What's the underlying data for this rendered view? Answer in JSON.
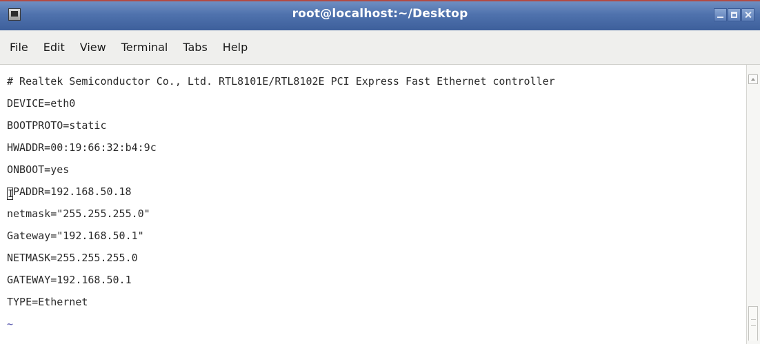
{
  "window": {
    "title": "root@localhost:~/Desktop"
  },
  "menu": {
    "items": [
      {
        "label": "File"
      },
      {
        "label": "Edit"
      },
      {
        "label": "View"
      },
      {
        "label": "Terminal"
      },
      {
        "label": "Tabs"
      },
      {
        "label": "Help"
      }
    ]
  },
  "terminal": {
    "lines": [
      "# Realtek Semiconductor Co., Ltd. RTL8101E/RTL8102E PCI Express Fast Ethernet controller",
      "DEVICE=eth0",
      "BOOTPROTO=static",
      "HWADDR=00:19:66:32:b4:9c",
      "ONBOOT=yes",
      "IPADDR=192.168.50.18",
      "netmask=\"255.255.255.0\"",
      "Gateway=\"192.168.50.1\"",
      "NETMASK=255.255.255.0",
      "GATEWAY=192.168.50.1",
      "TYPE=Ethernet",
      "~",
      "~"
    ],
    "cursor_line": {
      "cursor_char": "I",
      "rest": "PADDR=192.168.50.18"
    }
  },
  "icons": {
    "app": "terminal-icon",
    "minimize": "minimize-icon",
    "maximize": "maximize-icon",
    "close": "close-icon",
    "scroll_up": "scroll-up-arrow-icon"
  },
  "colors": {
    "titlebar": "#4f72ad",
    "title_text": "#ffffff",
    "terminal_bg": "#ffffff",
    "terminal_text": "#2a2a2a",
    "tilde": "#4a4aa8"
  }
}
